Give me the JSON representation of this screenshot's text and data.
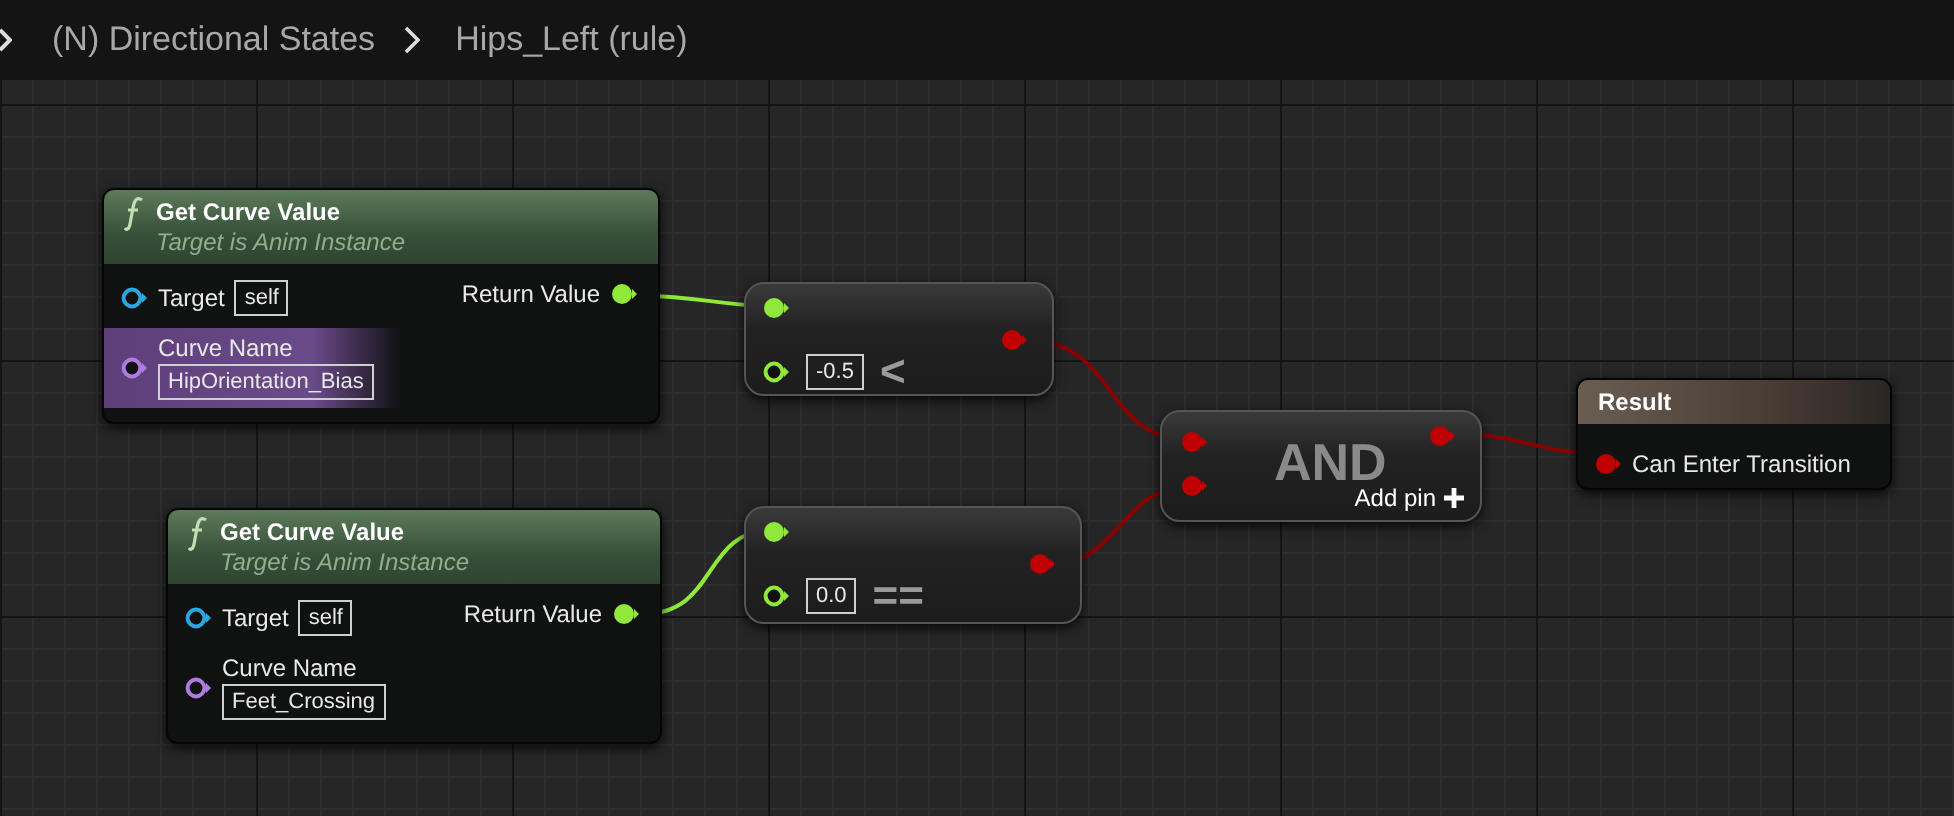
{
  "breadcrumb": [
    {
      "label": "(N) Directional States"
    },
    {
      "label": "Hips_Left (rule)"
    }
  ],
  "nodes": [
    {
      "kind": "function",
      "title": "Get Curve Value",
      "subtitle": "Target is Anim Instance",
      "target_label": "Target",
      "target_value": "self",
      "curve_label": "Curve Name",
      "curve_value": "HipOrientation_Bias",
      "curve_highlighted": true,
      "output": "Return Value"
    },
    {
      "kind": "function",
      "title": "Get Curve Value",
      "subtitle": "Target is Anim Instance",
      "target_label": "Target",
      "target_value": "self",
      "curve_label": "Curve Name",
      "curve_value": "Feet_Crossing",
      "curve_highlighted": false,
      "output": "Return Value"
    },
    {
      "kind": "operator",
      "symbol": "<",
      "value": "-0.5"
    },
    {
      "kind": "operator",
      "symbol": "==",
      "value": "0.0"
    },
    {
      "kind": "and",
      "title": "AND",
      "add_pin": "Add pin"
    },
    {
      "kind": "result",
      "title": "Result",
      "input": "Can Enter Transition"
    }
  ]
}
